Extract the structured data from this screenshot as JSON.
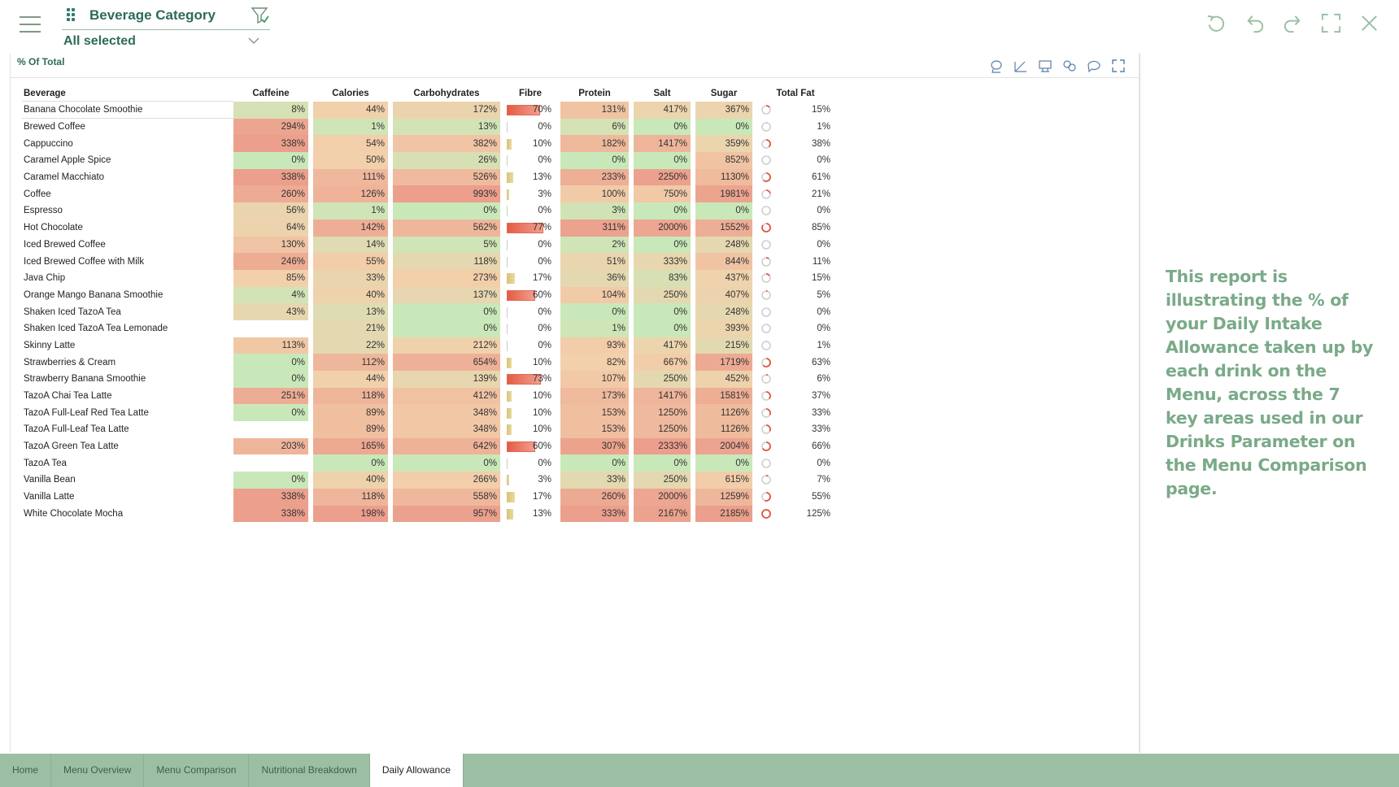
{
  "filter": {
    "title": "Beverage Category",
    "value": "All selected"
  },
  "toolbar": {
    "icons": [
      "reset-icon",
      "undo-icon",
      "redo-icon",
      "fullscreen-icon",
      "close-icon"
    ]
  },
  "panel": {
    "title": "% Of Total",
    "tools": [
      "lasso-icon",
      "chart-select-icon",
      "comment-icon",
      "share-icon",
      "chat-icon",
      "expand-icon"
    ]
  },
  "table": {
    "headers": [
      "Beverage",
      "Caffeine",
      "Calories",
      "Carbohydrates",
      "Fibre",
      "Protein",
      "Salt",
      "Sugar",
      "Total Fat"
    ],
    "rows": [
      {
        "beverage": "Banana Chocolate Smoothie",
        "caffeine": "8%",
        "calories": "44%",
        "carbs": "172%",
        "fibre": "70%",
        "protein": "131%",
        "salt": "417%",
        "sugar": "367%",
        "fat": "15%"
      },
      {
        "beverage": "Brewed Coffee",
        "caffeine": "294%",
        "calories": "1%",
        "carbs": "13%",
        "fibre": "0%",
        "protein": "6%",
        "salt": "0%",
        "sugar": "0%",
        "fat": "1%"
      },
      {
        "beverage": "Cappuccino",
        "caffeine": "338%",
        "calories": "54%",
        "carbs": "382%",
        "fibre": "10%",
        "protein": "182%",
        "salt": "1417%",
        "sugar": "359%",
        "fat": "38%"
      },
      {
        "beverage": "Caramel Apple Spice",
        "caffeine": "0%",
        "calories": "50%",
        "carbs": "26%",
        "fibre": "0%",
        "protein": "0%",
        "salt": "0%",
        "sugar": "852%",
        "fat": "0%"
      },
      {
        "beverage": "Caramel Macchiato",
        "caffeine": "338%",
        "calories": "111%",
        "carbs": "526%",
        "fibre": "13%",
        "protein": "233%",
        "salt": "2250%",
        "sugar": "1130%",
        "fat": "61%"
      },
      {
        "beverage": "Coffee",
        "caffeine": "260%",
        "calories": "126%",
        "carbs": "993%",
        "fibre": "3%",
        "protein": "100%",
        "salt": "750%",
        "sugar": "1981%",
        "fat": "21%"
      },
      {
        "beverage": "Espresso",
        "caffeine": "56%",
        "calories": "1%",
        "carbs": "0%",
        "fibre": "0%",
        "protein": "3%",
        "salt": "0%",
        "sugar": "0%",
        "fat": "0%"
      },
      {
        "beverage": "Hot Chocolate",
        "caffeine": "64%",
        "calories": "142%",
        "carbs": "562%",
        "fibre": "77%",
        "protein": "311%",
        "salt": "2000%",
        "sugar": "1552%",
        "fat": "85%"
      },
      {
        "beverage": "Iced Brewed Coffee",
        "caffeine": "130%",
        "calories": "14%",
        "carbs": "5%",
        "fibre": "0%",
        "protein": "2%",
        "salt": "0%",
        "sugar": "248%",
        "fat": "0%"
      },
      {
        "beverage": "Iced Brewed Coffee with Milk",
        "caffeine": "246%",
        "calories": "55%",
        "carbs": "118%",
        "fibre": "0%",
        "protein": "51%",
        "salt": "333%",
        "sugar": "844%",
        "fat": "11%"
      },
      {
        "beverage": "Java Chip",
        "caffeine": "85%",
        "calories": "33%",
        "carbs": "273%",
        "fibre": "17%",
        "protein": "36%",
        "salt": "83%",
        "sugar": "437%",
        "fat": "15%"
      },
      {
        "beverage": "Orange Mango Banana Smoothie",
        "caffeine": "4%",
        "calories": "40%",
        "carbs": "137%",
        "fibre": "60%",
        "protein": "104%",
        "salt": "250%",
        "sugar": "407%",
        "fat": "5%"
      },
      {
        "beverage": "Shaken Iced TazoA Tea",
        "caffeine": "43%",
        "calories": "13%",
        "carbs": "0%",
        "fibre": "0%",
        "protein": "0%",
        "salt": "0%",
        "sugar": "248%",
        "fat": "0%"
      },
      {
        "beverage": "Shaken Iced TazoA Tea Lemonade",
        "caffeine": "",
        "calories": "21%",
        "carbs": "0%",
        "fibre": "0%",
        "protein": "1%",
        "salt": "0%",
        "sugar": "393%",
        "fat": "0%"
      },
      {
        "beverage": "Skinny Latte",
        "caffeine": "113%",
        "calories": "22%",
        "carbs": "212%",
        "fibre": "0%",
        "protein": "93%",
        "salt": "417%",
        "sugar": "215%",
        "fat": "1%"
      },
      {
        "beverage": "Strawberries & Cream",
        "caffeine": "0%",
        "calories": "112%",
        "carbs": "654%",
        "fibre": "10%",
        "protein": "82%",
        "salt": "667%",
        "sugar": "1719%",
        "fat": "63%"
      },
      {
        "beverage": "Strawberry Banana Smoothie",
        "caffeine": "0%",
        "calories": "44%",
        "carbs": "139%",
        "fibre": "73%",
        "protein": "107%",
        "salt": "250%",
        "sugar": "452%",
        "fat": "6%"
      },
      {
        "beverage": "TazoA Chai Tea Latte",
        "caffeine": "251%",
        "calories": "118%",
        "carbs": "412%",
        "fibre": "10%",
        "protein": "173%",
        "salt": "1417%",
        "sugar": "1581%",
        "fat": "37%"
      },
      {
        "beverage": "TazoA Full-Leaf Red Tea Latte",
        "caffeine": "0%",
        "calories": "89%",
        "carbs": "348%",
        "fibre": "10%",
        "protein": "153%",
        "salt": "1250%",
        "sugar": "1126%",
        "fat": "33%"
      },
      {
        "beverage": "TazoA Full-Leaf Tea Latte",
        "caffeine": "",
        "calories": "89%",
        "carbs": "348%",
        "fibre": "10%",
        "protein": "153%",
        "salt": "1250%",
        "sugar": "1126%",
        "fat": "33%"
      },
      {
        "beverage": "TazoA Green Tea Latte",
        "caffeine": "203%",
        "calories": "165%",
        "carbs": "642%",
        "fibre": "60%",
        "protein": "307%",
        "salt": "2333%",
        "sugar": "2004%",
        "fat": "66%"
      },
      {
        "beverage": "TazoA Tea",
        "caffeine": "",
        "calories": "0%",
        "carbs": "0%",
        "fibre": "0%",
        "protein": "0%",
        "salt": "0%",
        "sugar": "0%",
        "fat": "0%"
      },
      {
        "beverage": "Vanilla Bean",
        "caffeine": "0%",
        "calories": "40%",
        "carbs": "266%",
        "fibre": "3%",
        "protein": "33%",
        "salt": "250%",
        "sugar": "615%",
        "fat": "7%"
      },
      {
        "beverage": "Vanilla Latte",
        "caffeine": "338%",
        "calories": "118%",
        "carbs": "558%",
        "fibre": "17%",
        "protein": "260%",
        "salt": "2000%",
        "sugar": "1259%",
        "fat": "55%"
      },
      {
        "beverage": "White Chocolate Mocha",
        "caffeine": "338%",
        "calories": "198%",
        "carbs": "957%",
        "fibre": "13%",
        "protein": "333%",
        "salt": "2167%",
        "sugar": "2185%",
        "fat": "125%"
      }
    ]
  },
  "colors": {
    "accent": "#2e6b58",
    "low": "#c9e8b9",
    "mid": "#f2d0ab",
    "high": "#eb9f8c",
    "fibre_high": "#e55b44",
    "fibre_low": "#d6c476",
    "tabbar": "#9cbfa3",
    "side_text": "#7aaa88"
  },
  "side_note": "This report is illustrating the % of your Daily Intake Allowance taken up by each drink on the Menu, across the 7 key areas used in our Drinks Parameter on the Menu Comparison page.",
  "tabs": [
    {
      "label": "Home",
      "active": false
    },
    {
      "label": "Menu Overview",
      "active": false
    },
    {
      "label": "Menu Comparison",
      "active": false
    },
    {
      "label": "Nutritional Breakdown",
      "active": false
    },
    {
      "label": "Daily Allowance",
      "active": true
    }
  ]
}
